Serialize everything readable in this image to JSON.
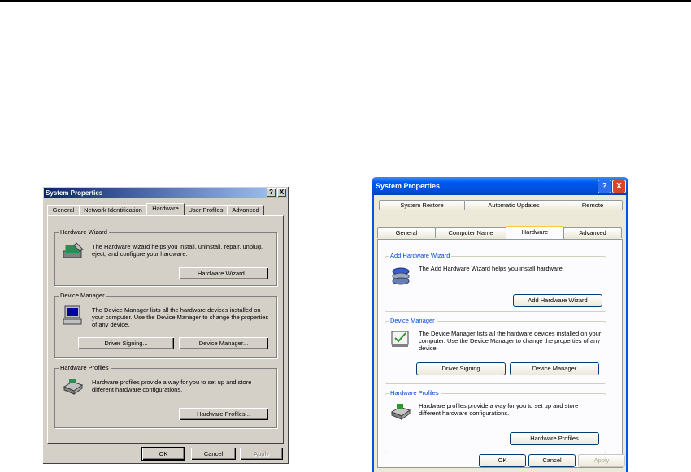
{
  "left_dialog": {
    "title": "System Properties",
    "help_btn": "?",
    "close_btn": "X",
    "tabs": [
      "General",
      "Network Identification",
      "Hardware",
      "User Profiles",
      "Advanced"
    ],
    "active_tab": "Hardware",
    "groups": {
      "wizard": {
        "label": "Hardware Wizard",
        "text": "The Hardware wizard helps you install, uninstall, repair, unplug, eject, and configure your hardware.",
        "button": "Hardware Wizard..."
      },
      "devmgr": {
        "label": "Device Manager",
        "text": "The Device Manager lists all the hardware devices installed on your computer. Use the Device Manager to change the properties of any device.",
        "button_signing": "Driver Signing...",
        "button_manager": "Device Manager..."
      },
      "profiles": {
        "label": "Hardware Profiles",
        "text": "Hardware profiles provide a way for you to set up and store different hardware configurations.",
        "button": "Hardware Profiles..."
      }
    },
    "ok": "OK",
    "cancel": "Cancel",
    "apply": "Apply"
  },
  "right_dialog": {
    "title": "System Properties",
    "help_btn": "?",
    "close_btn": "X",
    "tabs_row1": [
      "System Restore",
      "Automatic Updates",
      "Remote"
    ],
    "tabs_row2": [
      "General",
      "Computer Name",
      "Hardware",
      "Advanced"
    ],
    "active_tab": "Hardware",
    "groups": {
      "wizard": {
        "label": "Add Hardware Wizard",
        "text": "The Add Hardware Wizard helps you install hardware.",
        "button": "Add Hardware Wizard"
      },
      "devmgr": {
        "label": "Device Manager",
        "text": "The Device Manager lists all the hardware devices installed on your computer. Use the Device Manager to change the properties of any device.",
        "button_signing": "Driver Signing",
        "button_manager": "Device Manager"
      },
      "profiles": {
        "label": "Hardware Profiles",
        "text": "Hardware profiles provide a way for you to set up and store different hardware configurations.",
        "button": "Hardware Profiles"
      }
    },
    "ok": "OK",
    "cancel": "Cancel",
    "apply": "Apply"
  }
}
